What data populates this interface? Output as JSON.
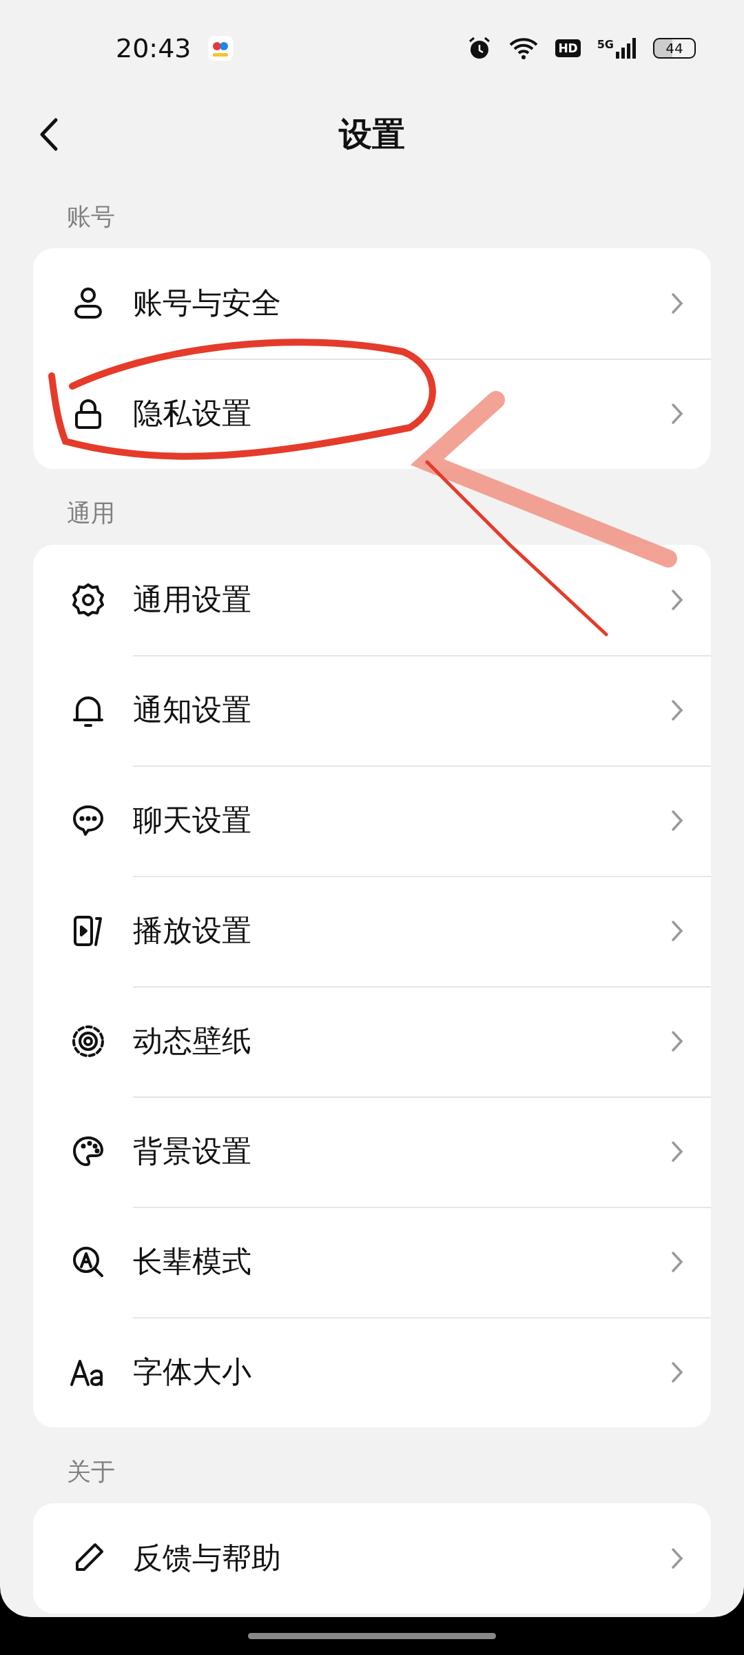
{
  "status_bar": {
    "time": "20:43",
    "hd": "HD",
    "network": "5G",
    "battery": "44"
  },
  "header": {
    "title": "设置"
  },
  "sections": [
    {
      "label": "账号",
      "items": [
        {
          "label": "账号与安全"
        },
        {
          "label": "隐私设置"
        }
      ]
    },
    {
      "label": "通用",
      "items": [
        {
          "label": "通用设置"
        },
        {
          "label": "通知设置"
        },
        {
          "label": "聊天设置"
        },
        {
          "label": "播放设置"
        },
        {
          "label": "动态壁纸"
        },
        {
          "label": "背景设置"
        },
        {
          "label": "长辈模式"
        },
        {
          "label": "字体大小"
        }
      ]
    },
    {
      "label": "关于",
      "items": [
        {
          "label": "反馈与帮助"
        }
      ]
    }
  ]
}
